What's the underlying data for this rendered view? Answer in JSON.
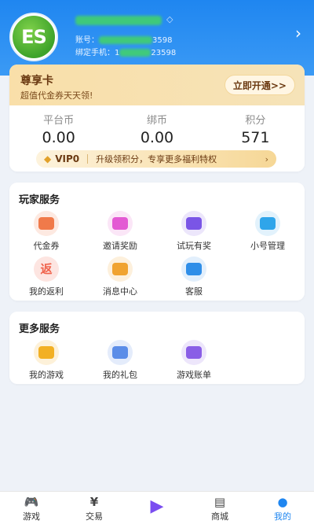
{
  "profile": {
    "avatar_text": "ES",
    "account_label": "账号：",
    "account_suffix": "3598",
    "phone_label": "绑定手机：",
    "phone_prefix": "1",
    "phone_suffix": "23598"
  },
  "vip_card": {
    "title": "尊享卡",
    "subtitle": "超值代金券天天领!",
    "open_button": "立即开通>>"
  },
  "stats": [
    {
      "label": "平台币",
      "value": "0.00"
    },
    {
      "label": "绑币",
      "value": "0.00"
    },
    {
      "label": "积分",
      "value": "571"
    }
  ],
  "vip_bar": {
    "level": "VIP0",
    "message": "升级领积分，专享更多福利特权",
    "arrow": "›"
  },
  "player_services": {
    "title": "玩家服务",
    "items": [
      {
        "label": "代金券",
        "icon": "voucher-icon",
        "color": "#f07a4a",
        "bg": "#fde9e1"
      },
      {
        "label": "邀请奖励",
        "icon": "invite-icon",
        "color": "#e35ad3",
        "bg": "#fbe6f7"
      },
      {
        "label": "试玩有奖",
        "icon": "gamepad-icon",
        "color": "#7a55e6",
        "bg": "#ece6fb"
      },
      {
        "label": "小号管理",
        "icon": "user-icon",
        "color": "#2fa5ea",
        "bg": "#e2f2fc"
      },
      {
        "label": "我的返利",
        "icon": "rebate-icon",
        "color": "#f0634c",
        "bg": "#fde5e1",
        "glyph": "返"
      },
      {
        "label": "消息中心",
        "icon": "message-icon",
        "color": "#f0a330",
        "bg": "#fdf0dc"
      },
      {
        "label": "客服",
        "icon": "support-icon",
        "color": "#2f8ee8",
        "bg": "#e2effc"
      }
    ]
  },
  "more_services": {
    "title": "更多服务",
    "items": [
      {
        "label": "我的游戏",
        "icon": "pacman-icon",
        "color": "#f2b024",
        "bg": "#fdf1d9"
      },
      {
        "label": "我的礼包",
        "icon": "gift-icon",
        "color": "#5b8de8",
        "bg": "#e4ecfb"
      },
      {
        "label": "游戏账单",
        "icon": "bill-icon",
        "color": "#8a5ee6",
        "bg": "#ede6fb"
      }
    ]
  },
  "tabs": [
    {
      "label": "游戏",
      "icon": "gamepad-tab-icon"
    },
    {
      "label": "交易",
      "icon": "trade-icon"
    },
    {
      "label": "",
      "icon": "play-center-icon"
    },
    {
      "label": "商城",
      "icon": "shop-icon"
    },
    {
      "label": "我的",
      "icon": "me-icon",
      "active": true
    }
  ]
}
